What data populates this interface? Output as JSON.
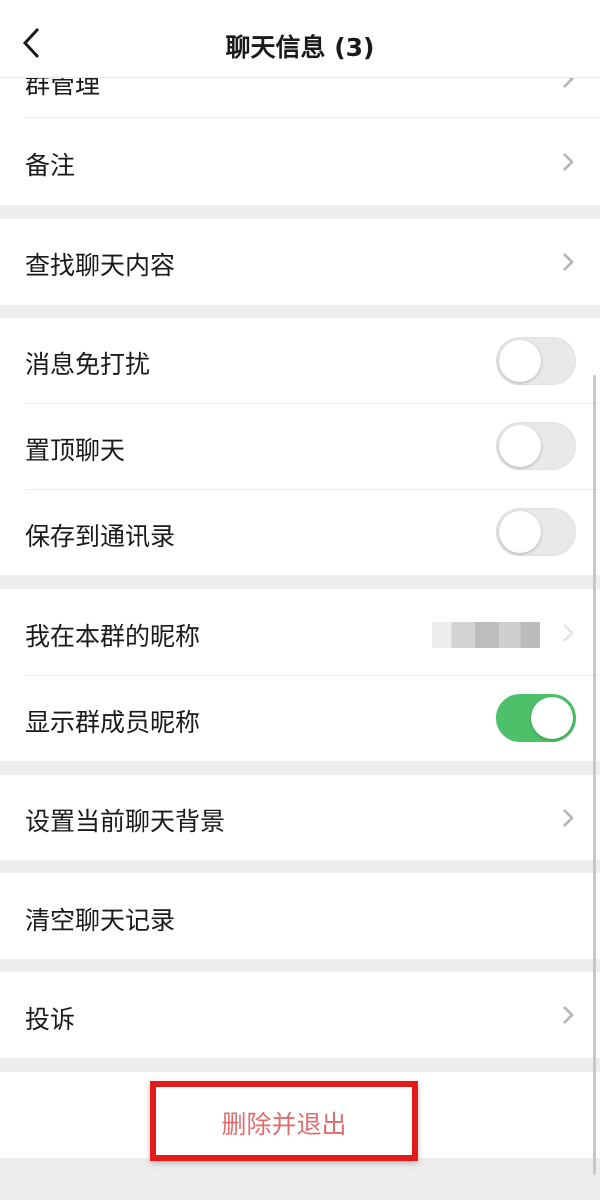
{
  "header": {
    "title": "聊天信息 (3)",
    "back_icon": "chevron-left-icon"
  },
  "rows": {
    "group_manage": "群管理",
    "remark": "备注",
    "search_chat": "查找聊天内容",
    "mute": "消息免打扰",
    "sticky": "置顶聊天",
    "save_contacts": "保存到通讯录",
    "my_nickname": "我在本群的昵称",
    "show_nicknames": "显示群成员昵称",
    "set_background": "设置当前聊天背景",
    "clear_history": "清空聊天记录",
    "complain": "投诉"
  },
  "toggles": {
    "mute": false,
    "sticky": false,
    "save_contacts": false,
    "show_nicknames": true
  },
  "actions": {
    "delete_exit": "删除并退出"
  },
  "colors": {
    "accent_green": "#4dc16a",
    "danger_text": "#e06d6d",
    "highlight_red": "#e41b1b",
    "page_bg": "#ededed"
  }
}
